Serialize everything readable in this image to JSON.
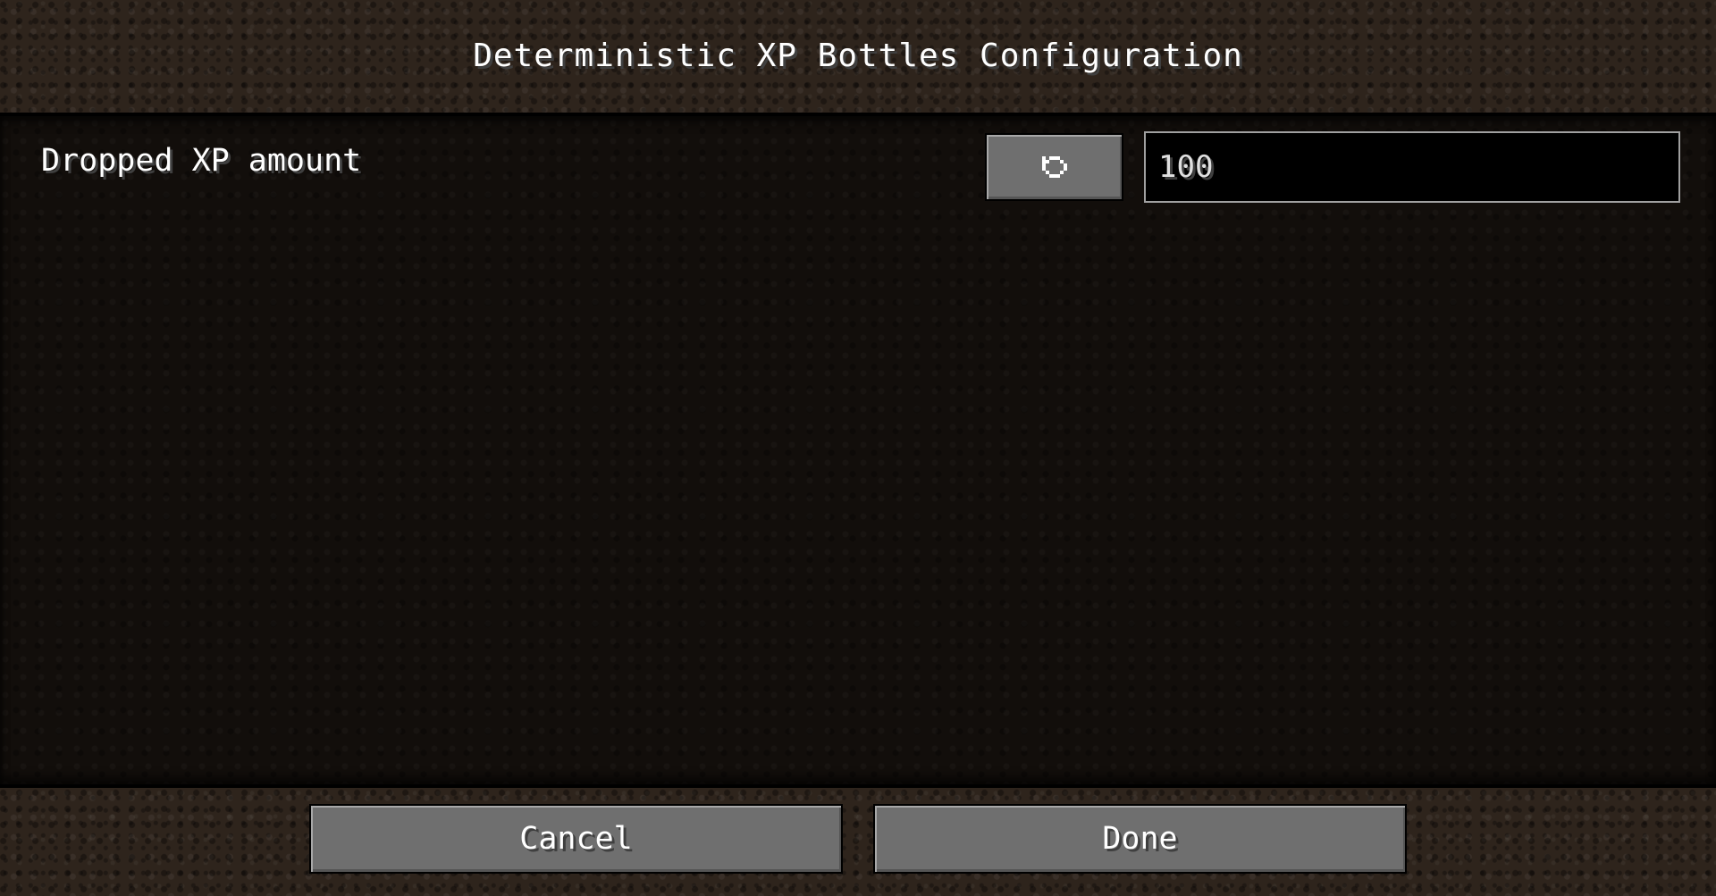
{
  "screen": {
    "title": "Deterministic XP Bottles Configuration"
  },
  "entries": [
    {
      "label": "Dropped XP amount",
      "reset_icon": "reset-arrow-icon",
      "value": "100"
    }
  ],
  "footer": {
    "cancel_label": "Cancel",
    "done_label": "Done"
  },
  "colors": {
    "button_face": "#6f6f6f",
    "input_background": "#000000",
    "input_border": "#a0a0a0",
    "text": "#ffffff"
  }
}
